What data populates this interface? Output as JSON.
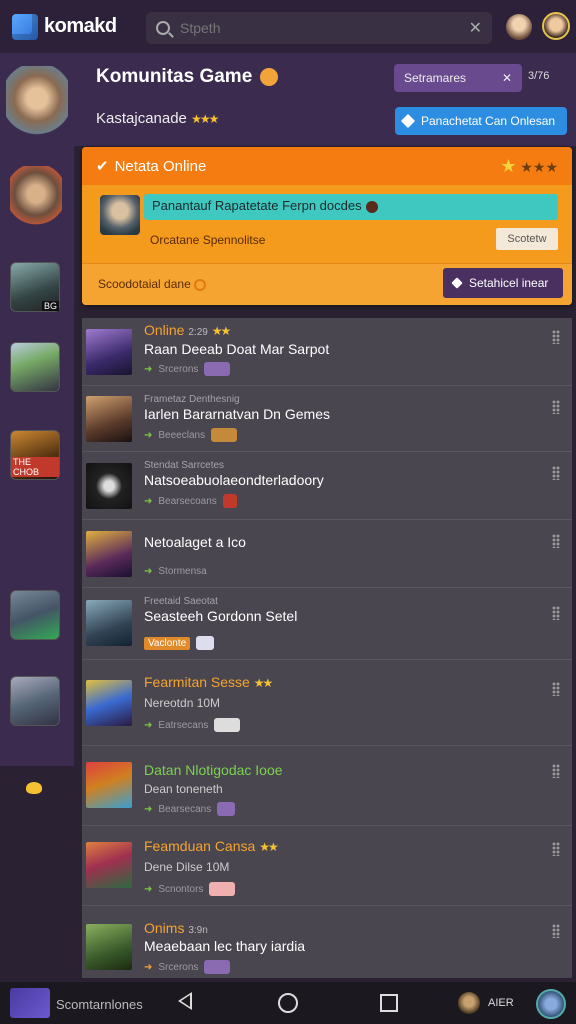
{
  "topbar": {
    "logo_text": "komakd",
    "search_placeholder": "Stpeth",
    "clear_label": "✕"
  },
  "header": {
    "title": "Komunitas Game",
    "subtitle": "Kastajcanade",
    "filter_label": "Setramares",
    "filter_close": "✕",
    "filter_count": "3/76",
    "join_button": "Panachetat Can Onlesan"
  },
  "online_card": {
    "title": "Netata Online",
    "highlight": "Panantauf Rapatetate  Ferpn docdes",
    "line": "Orcatane Spennolitse",
    "mini_button": "Scotetw",
    "status": "Scoodotaial dane",
    "action_button": "Setahicel inear"
  },
  "sidebar": {
    "tags": [
      "BG",
      "THE CHOB"
    ]
  },
  "rows": [
    {
      "status": "Online",
      "status_extra": "2:29",
      "status_color": "orange",
      "title": "Raan Deeab Doat Mar Sarpot",
      "sub": "Srcerons"
    },
    {
      "status": "Frametaz Denthesnig",
      "status_extra": "",
      "status_color": "grey",
      "title": "Iarlen Bararnatvan Dn Gemes",
      "sub": "Beeeclans"
    },
    {
      "status": "Stendat Sarrcetes",
      "status_extra": "",
      "status_color": "grey",
      "title": "Natsoeabuolaeondterladoory",
      "sub": "Bearsecoans"
    },
    {
      "status": "",
      "status_extra": "",
      "status_color": "grey",
      "title": "Netoalaget a Ico",
      "sub": "Stormensa"
    },
    {
      "status": "Freetaid Saeotat",
      "status_extra": "",
      "status_color": "grey",
      "title": "Seasteeh Gordonn Setel",
      "sub": "Vaclonte"
    },
    {
      "status": "Fearmitan Sesse",
      "status_extra": "",
      "status_color": "orange",
      "title": "Nereotdn 10M",
      "sub": "Eatrsecans"
    },
    {
      "status": "Datan Nlotigodac",
      "status_extra": "Iooe",
      "status_color": "green",
      "title": "Dean toneneth",
      "sub": "Bearsecans"
    },
    {
      "status": "Feamduan Cansa",
      "status_extra": "",
      "status_color": "orange",
      "title": "Dene Dilse 10M",
      "sub": "Scnontors"
    },
    {
      "status": "Onims",
      "status_extra": "3:9n",
      "status_color": "orange",
      "title": "Meaebaan lec thary iardia",
      "sub": "Srcerons"
    }
  ],
  "navbar": {
    "app_label": "Scomtarnlones",
    "user_label": "AIER"
  },
  "colors": {
    "accent_orange": "#f57c10",
    "teal": "#3ec8c0",
    "purple": "#3a2b4f",
    "blue": "#2d8de0"
  }
}
